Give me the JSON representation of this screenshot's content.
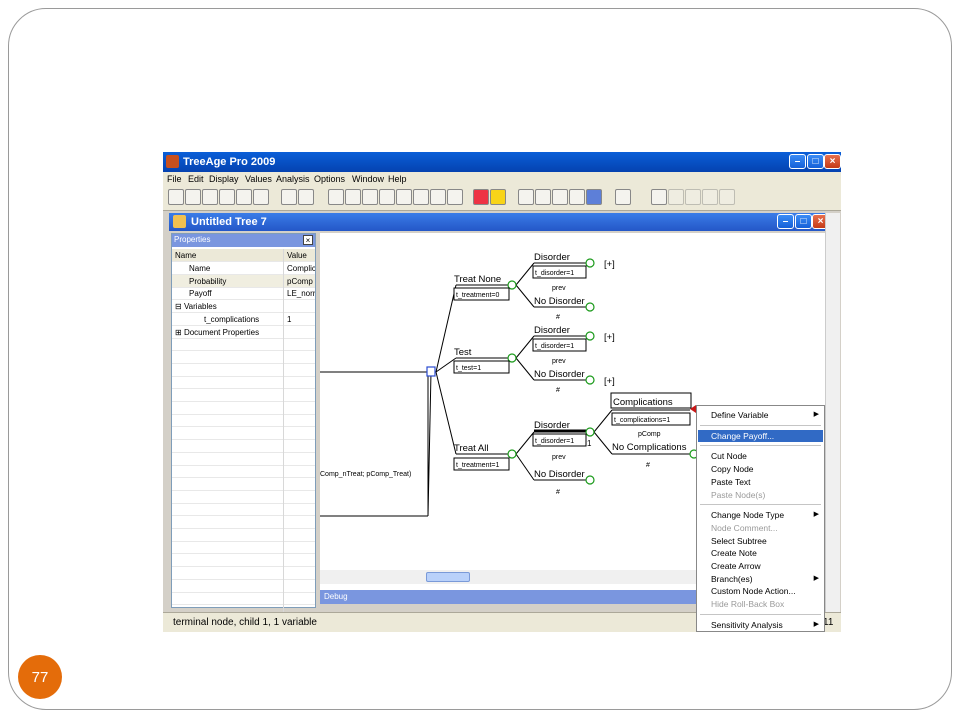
{
  "slide": {
    "page_number": "77"
  },
  "app": {
    "title": "TreeAge Pro 2009"
  },
  "menu": [
    "File",
    "Edit",
    "Display",
    "Values",
    "Analysis",
    "Options",
    "Window",
    "Help"
  ],
  "window": {
    "title": "Untitled Tree 7"
  },
  "properties": {
    "title": "Properties",
    "columns": [
      "Name",
      "Value"
    ],
    "rows": [
      {
        "name": "Name",
        "value": "Complic"
      },
      {
        "name": "Probability",
        "value": "pComp"
      },
      {
        "name": "Payoff",
        "value": "LE_norr"
      },
      {
        "name": "Variables",
        "value": ""
      },
      {
        "name": "t_complications",
        "value": "1"
      },
      {
        "name": "Document Properties",
        "value": ""
      }
    ]
  },
  "tree": {
    "root_payoff": "Comp_nTreat; pComp_Treat)",
    "treat_none": {
      "label": "Treat None",
      "def": "t_treatment=0"
    },
    "test": {
      "label": "Test",
      "def": "t_test=1"
    },
    "treat_all": {
      "label": "Treat All",
      "def": "t_treatment=1"
    },
    "disorder": "Disorder",
    "disorder_def": "t_disorder=1",
    "prev": "prev",
    "no_disorder": "No Disorder",
    "hash": "#",
    "plus": "[+]",
    "complications": "Complications",
    "complications_def": "t_complications=1",
    "pcomp": "pComp",
    "no_complications": "No Complications",
    "one": "1"
  },
  "context_menu": [
    {
      "label": "Define Variable",
      "submenu": true
    },
    {
      "sep": true
    },
    {
      "label": "Change Payoff...",
      "highlight": true
    },
    {
      "sep": true
    },
    {
      "label": "Cut Node"
    },
    {
      "label": "Copy Node"
    },
    {
      "label": "Paste Text"
    },
    {
      "label": "Paste Node(s)",
      "disabled": true
    },
    {
      "sep": true
    },
    {
      "label": "Change Node Type",
      "submenu": true
    },
    {
      "label": "Node Comment...",
      "disabled": true
    },
    {
      "label": "Select Subtree"
    },
    {
      "label": "Create Note"
    },
    {
      "label": "Create Arrow"
    },
    {
      "label": "Branch(es)",
      "submenu": true
    },
    {
      "label": "Custom Node Action..."
    },
    {
      "label": "Hide Roll-Back Box",
      "disabled": true
    },
    {
      "sep": true
    },
    {
      "label": "Sensitivity Analysis",
      "submenu": true
    }
  ],
  "debug": {
    "label": "Debug"
  },
  "status": {
    "text": "terminal node, child 1, 1 variable",
    "right": "11"
  }
}
